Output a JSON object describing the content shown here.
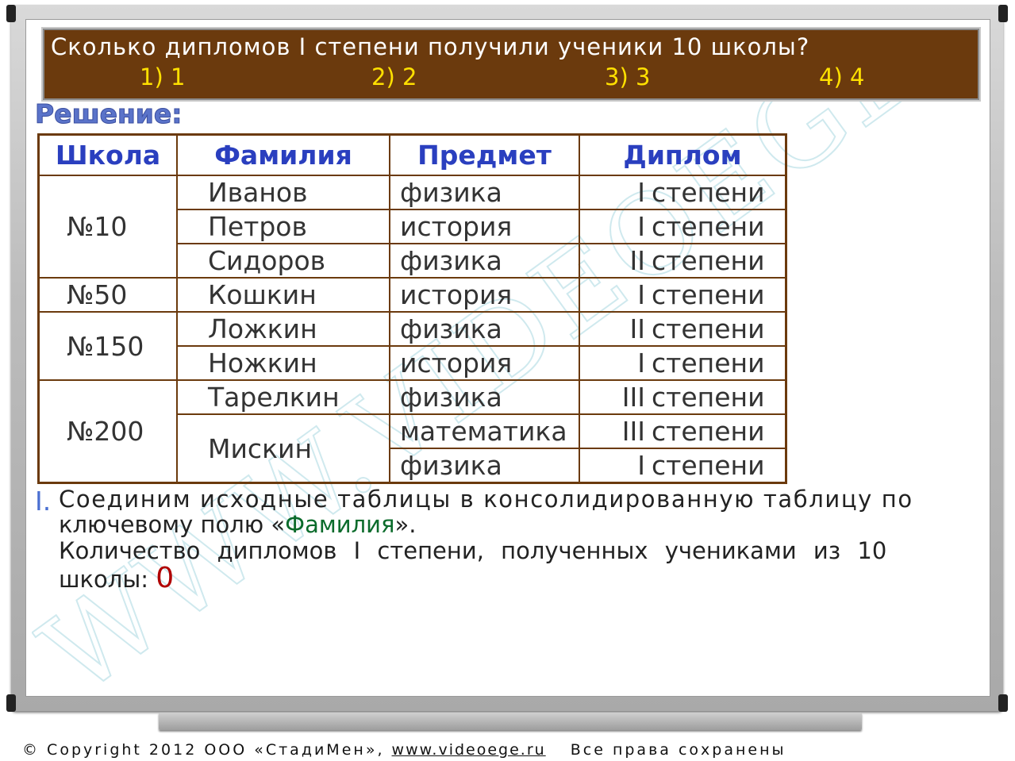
{
  "question": {
    "text": "Сколько дипломов I степени получили ученики 10 школы?",
    "options": [
      "1) 1",
      "2) 2",
      "3) 3",
      "4) 4"
    ]
  },
  "solution_heading": "Решение:",
  "table": {
    "headers": [
      "Школа",
      "Фамилия",
      "Предмет",
      "Диплом"
    ],
    "schools": [
      "№10",
      "№50",
      "№150",
      "№200"
    ],
    "rows": [
      {
        "surname": "Иванов",
        "subject": "физика",
        "roman": "I",
        "degree": "степени"
      },
      {
        "surname": "Петров",
        "subject": "история",
        "roman": "I",
        "degree": "степени"
      },
      {
        "surname": "Сидоров",
        "subject": "физика",
        "roman": "II",
        "degree": "степени"
      },
      {
        "surname": "Кошкин",
        "subject": "история",
        "roman": "I",
        "degree": "степени"
      },
      {
        "surname": "Ложкин",
        "subject": "физика",
        "roman": "II",
        "degree": "степени"
      },
      {
        "surname": "Ножкин",
        "subject": "история",
        "roman": "I",
        "degree": "степени"
      },
      {
        "surname": "Тарелкин",
        "subject": "физика",
        "roman": "III",
        "degree": "степени"
      },
      {
        "surname": "Мискин",
        "subject": "математика",
        "roman": "III",
        "degree": "степени"
      },
      {
        "surname": "",
        "subject": "физика",
        "roman": "I",
        "degree": "степени"
      }
    ]
  },
  "solution": {
    "marker": "I.",
    "line1": "Соединим исходные таблицы в консолидированную таблицу по",
    "line2_pre": "ключевому полю «",
    "line2_field": "Фамилия",
    "line2_post": "».",
    "line3": "Количество дипломов I степени, полученных учениками из 10",
    "line4": "школы:",
    "answer": "0"
  },
  "watermark": "WWW.VIDEOEGE.RU",
  "footer": {
    "copyright": "Copyright 2012 ООО «СтадиМен»,",
    "site": "www.videoege.ru",
    "rights": "Все права сохранены"
  },
  "colors": {
    "question_bg": "#6b3a0d",
    "options": "#ffe000",
    "headers": "#2a3fbf",
    "field": "#0b6b2b",
    "answer": "#b00000"
  }
}
